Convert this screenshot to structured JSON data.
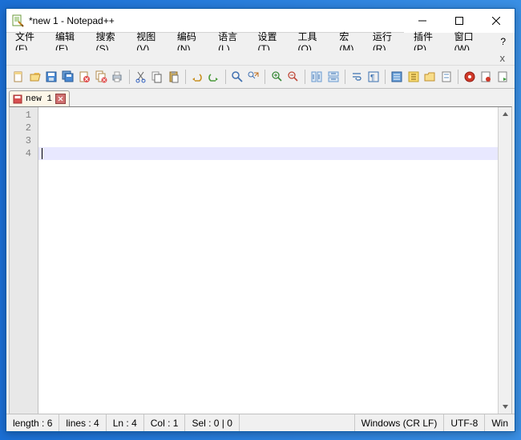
{
  "title": "*new 1 - Notepad++",
  "menus": [
    "文件(F)",
    "编辑(E)",
    "搜索(S)",
    "视图(V)",
    "编码(N)",
    "语言(L)",
    "设置(T)",
    "工具(O)",
    "宏(M)",
    "运行(R)",
    "插件(P)",
    "窗口(W)"
  ],
  "menu_help": "?",
  "overflow_close": "x",
  "tab": {
    "label": "new 1"
  },
  "gutter_lines": [
    "1",
    "2",
    "3",
    "4"
  ],
  "current_line_index": 3,
  "status": {
    "length": "length : 6",
    "lines": "lines : 4",
    "ln": "Ln : 4",
    "col": "Col : 1",
    "sel": "Sel : 0 | 0",
    "eol": "Windows (CR LF)",
    "enc": "UTF-8",
    "ins": "Win"
  },
  "icons": {
    "new": "new-file-icon",
    "open": "open-folder-icon",
    "save": "save-icon",
    "saveall": "save-all-icon",
    "close": "close-file-icon",
    "closeall": "close-all-icon",
    "print": "print-icon",
    "cut": "cut-icon",
    "copy": "copy-icon",
    "paste": "paste-icon",
    "undo": "undo-icon",
    "redo": "redo-icon",
    "find": "find-icon",
    "replace": "replace-icon",
    "zoomin": "zoom-in-icon",
    "zoomout": "zoom-out-icon",
    "sync": "sync-scroll-icon",
    "syncv": "sync-vscroll-icon",
    "wrap": "word-wrap-icon",
    "ws": "show-ws-icon",
    "indent": "indent-guide-icon",
    "lang": "lang-icon",
    "doc": "doc-map-icon",
    "folder": "folder-panel-icon",
    "monitor": "monitor-icon",
    "rec": "record-macro-icon",
    "play": "play-macro-icon"
  }
}
